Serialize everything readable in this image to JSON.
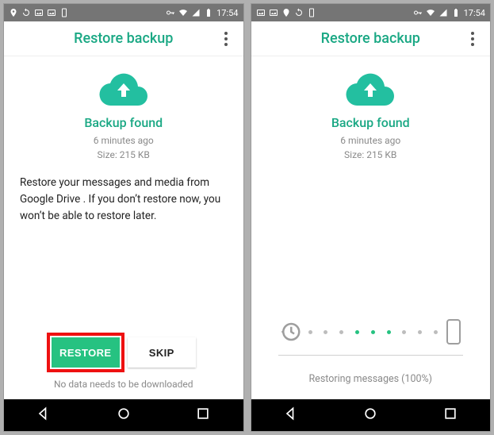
{
  "status": {
    "time": "17:54"
  },
  "header": {
    "title": "Restore backup"
  },
  "backup": {
    "found_label": "Backup found",
    "age": "6 minutes ago",
    "size": "Size: 215 KB"
  },
  "left": {
    "body": "Restore your messages and media from Google Drive . If you don’t restore now, you won’t be able to restore later.",
    "restore_label": "RESTORE",
    "skip_label": "SKIP",
    "footer": "No data needs to be downloaded"
  },
  "right": {
    "status": "Restoring messages (100%)"
  }
}
